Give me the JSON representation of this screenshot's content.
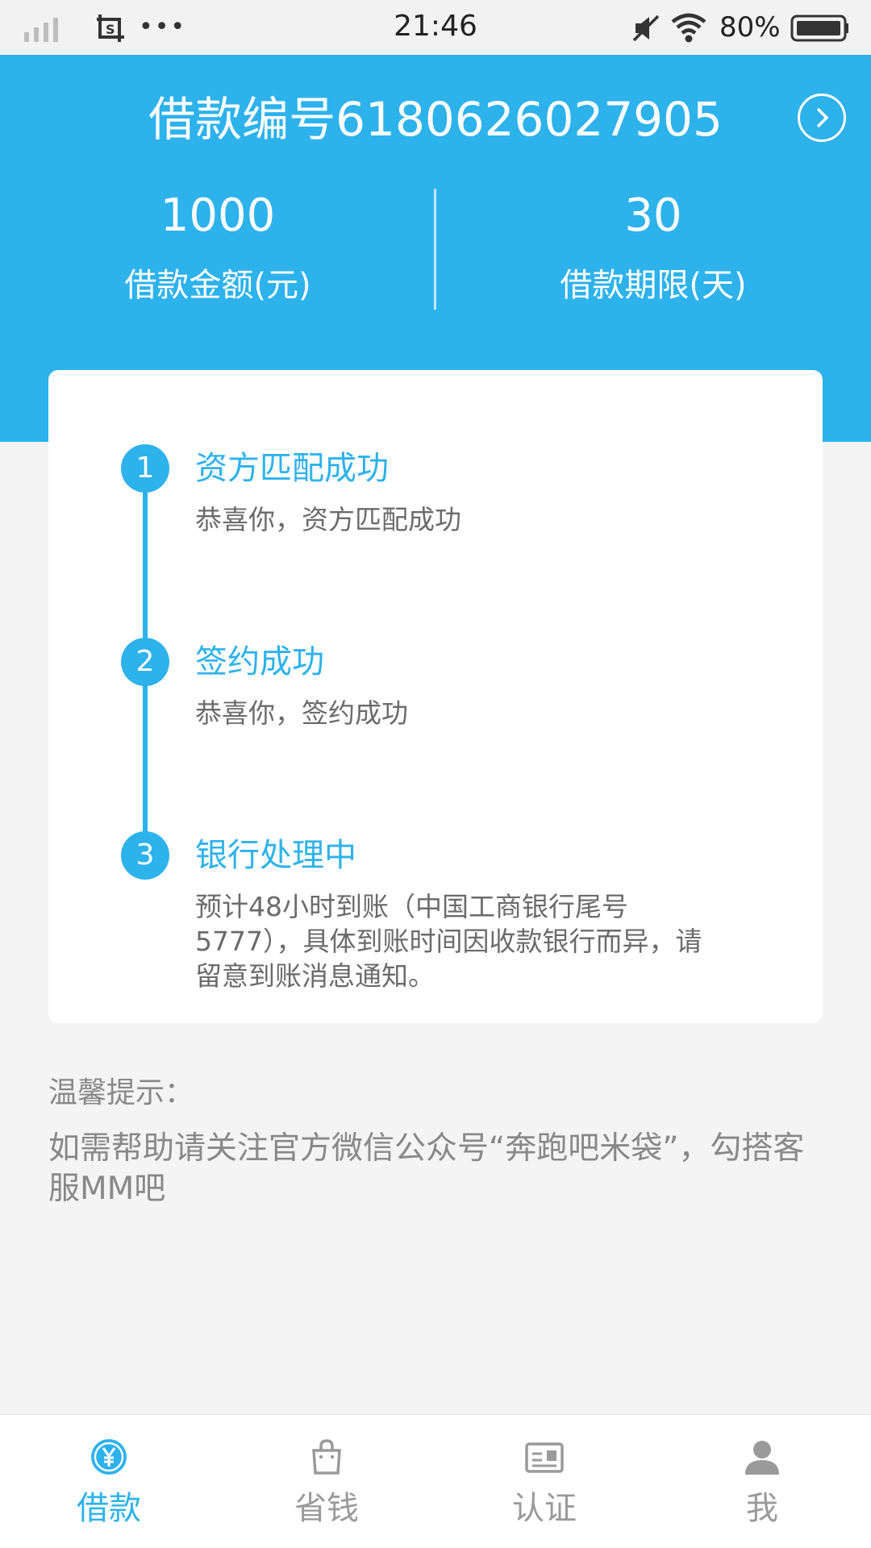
{
  "status_bar": {
    "time": "21:46",
    "battery": "80%",
    "more": "•••"
  },
  "header": {
    "loan_number": "借款编号6180626027905",
    "amount": {
      "value": "1000",
      "label": "借款金额(元)"
    },
    "term": {
      "value": "30",
      "label": "借款期限(天)"
    }
  },
  "steps": [
    {
      "num": "1",
      "title": "资方匹配成功",
      "desc": "恭喜你，资方匹配成功"
    },
    {
      "num": "2",
      "title": "签约成功",
      "desc": "恭喜你，签约成功"
    },
    {
      "num": "3",
      "title": "银行处理中",
      "desc": "预计48小时到账（中国工商银行尾号5777），具体到账时间因收款银行而异，请留意到账消息通知。"
    }
  ],
  "tips": {
    "title": "温馨提示：",
    "body": "如需帮助请关注官方微信公众号“奔跑吧米袋”，勾搭客服MM吧"
  },
  "tabbar": {
    "items": [
      {
        "label": "借款",
        "icon": "yen-circle-icon",
        "active": true
      },
      {
        "label": "省钱",
        "icon": "shopping-bag-icon",
        "active": false
      },
      {
        "label": "认证",
        "icon": "id-card-icon",
        "active": false
      },
      {
        "label": "我",
        "icon": "person-icon",
        "active": false
      }
    ]
  },
  "colors": {
    "accent": "#2db2ec",
    "background": "#f4f4f4",
    "muted_text": "#888888",
    "tab_inactive": "#9a9a9a"
  }
}
